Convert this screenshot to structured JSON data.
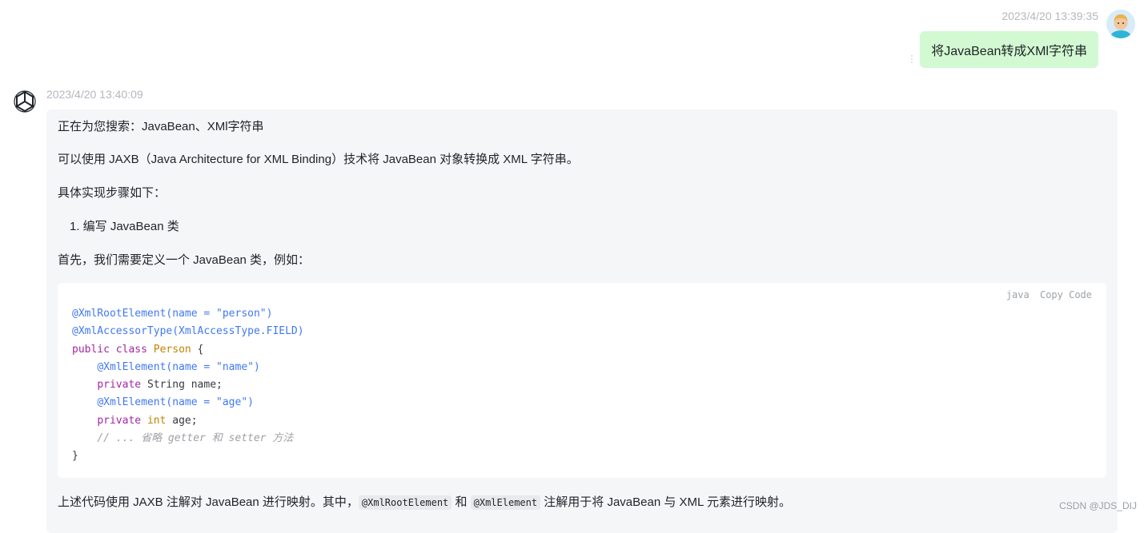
{
  "user_message": {
    "timestamp": "2023/4/20 13:39:35",
    "text": "将JavaBean转成XMl字符串"
  },
  "bot_message": {
    "timestamp": "2023/4/20 13:40:09",
    "searching": "正在为您搜索：JavaBean、XMl字符串",
    "intro": "可以使用 JAXB（Java Architecture for XML Binding）技术将 JavaBean 对象转换成 XML 字符串。",
    "steps_heading": "具体实现步骤如下：",
    "step1": "1. 编写 JavaBean 类",
    "step1_desc": "首先，我们需要定义一个 JavaBean 类，例如：",
    "code": {
      "language": "java",
      "copy_label": "Copy Code",
      "lines": [
        [
          {
            "t": "ann",
            "s": "@XmlRootElement(name = \"person\")"
          }
        ],
        [
          {
            "t": "ann",
            "s": "@XmlAccessorType(XmlAccessType.FIELD)"
          }
        ],
        [
          {
            "t": "kw",
            "s": "public "
          },
          {
            "t": "kw",
            "s": "class "
          },
          {
            "t": "cls",
            "s": "Person"
          },
          {
            "t": "",
            "s": " {"
          }
        ],
        [
          {
            "t": "",
            "s": "    "
          },
          {
            "t": "ann",
            "s": "@XmlElement(name = \"name\")"
          }
        ],
        [
          {
            "t": "",
            "s": "    "
          },
          {
            "t": "kw",
            "s": "private "
          },
          {
            "t": "",
            "s": "String name;"
          }
        ],
        [
          {
            "t": "",
            "s": "    "
          },
          {
            "t": "ann",
            "s": "@XmlElement(name = \"age\")"
          }
        ],
        [
          {
            "t": "",
            "s": "    "
          },
          {
            "t": "kw",
            "s": "private "
          },
          {
            "t": "cls",
            "s": "int"
          },
          {
            "t": "",
            "s": " age;"
          }
        ],
        [
          {
            "t": "",
            "s": "    "
          },
          {
            "t": "cmt",
            "s": "// ... 省略 getter 和 setter 方法"
          }
        ],
        [
          {
            "t": "",
            "s": "}"
          }
        ]
      ]
    },
    "after_code_part1": "上述代码使用 JAXB 注解对 JavaBean 进行映射。其中，",
    "inline_code1": "@XmlRootElement",
    "after_code_part2": " 和 ",
    "inline_code2": "@XmlElement",
    "after_code_part3": " 注解用于将 JavaBean 与 XML 元素进行映射。"
  },
  "watermark": "CSDN @JDS_DIJ",
  "icons": {
    "bot_avatar": "openai-logo-icon",
    "user_avatar": "user-avatar-icon",
    "more": "more-vertical-icon"
  }
}
